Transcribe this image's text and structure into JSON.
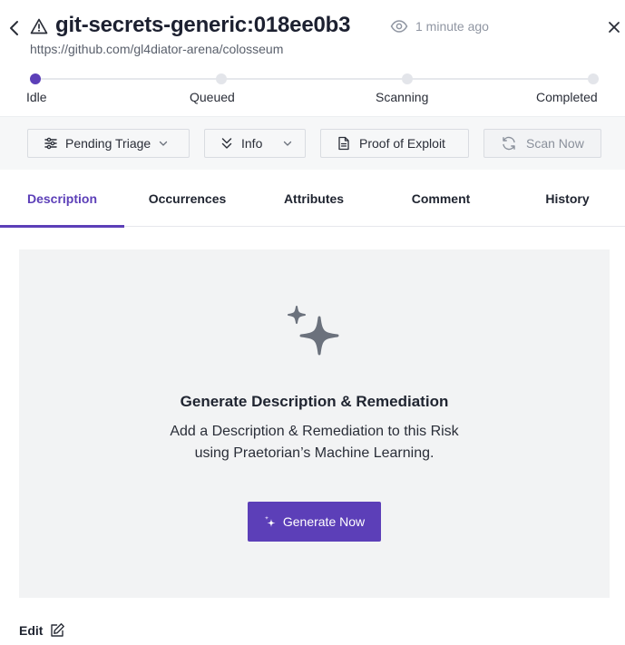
{
  "header": {
    "title": "git-secrets-generic:018ee0b3",
    "timestamp": "1 minute ago",
    "url": "https://github.com/gl4diator-arena/colosseum",
    "icons": {
      "back": "chevron-left-icon",
      "warning": "warning-triangle-icon",
      "watch": "eye-icon",
      "close": "close-icon"
    }
  },
  "progress": {
    "steps": [
      "Idle",
      "Queued",
      "Scanning",
      "Completed"
    ],
    "current": "Idle",
    "accent": "#5c3fb8"
  },
  "toolbar": {
    "status_label": "Pending Triage",
    "severity_label": "Info",
    "proof_label": "Proof of Exploit",
    "scan_label": "Scan Now"
  },
  "tabs": [
    "Description",
    "Occurrences",
    "Attributes",
    "Comment",
    "History"
  ],
  "active_tab": "Description",
  "description": {
    "title": "Generate Description & Remediation",
    "line1": "Add a Description & Remediation to this Risk",
    "line2": "using Praetorian’s Machine Learning.",
    "button_label": "Generate Now",
    "edit_label": "Edit",
    "button_color": "#5c3fb8"
  }
}
